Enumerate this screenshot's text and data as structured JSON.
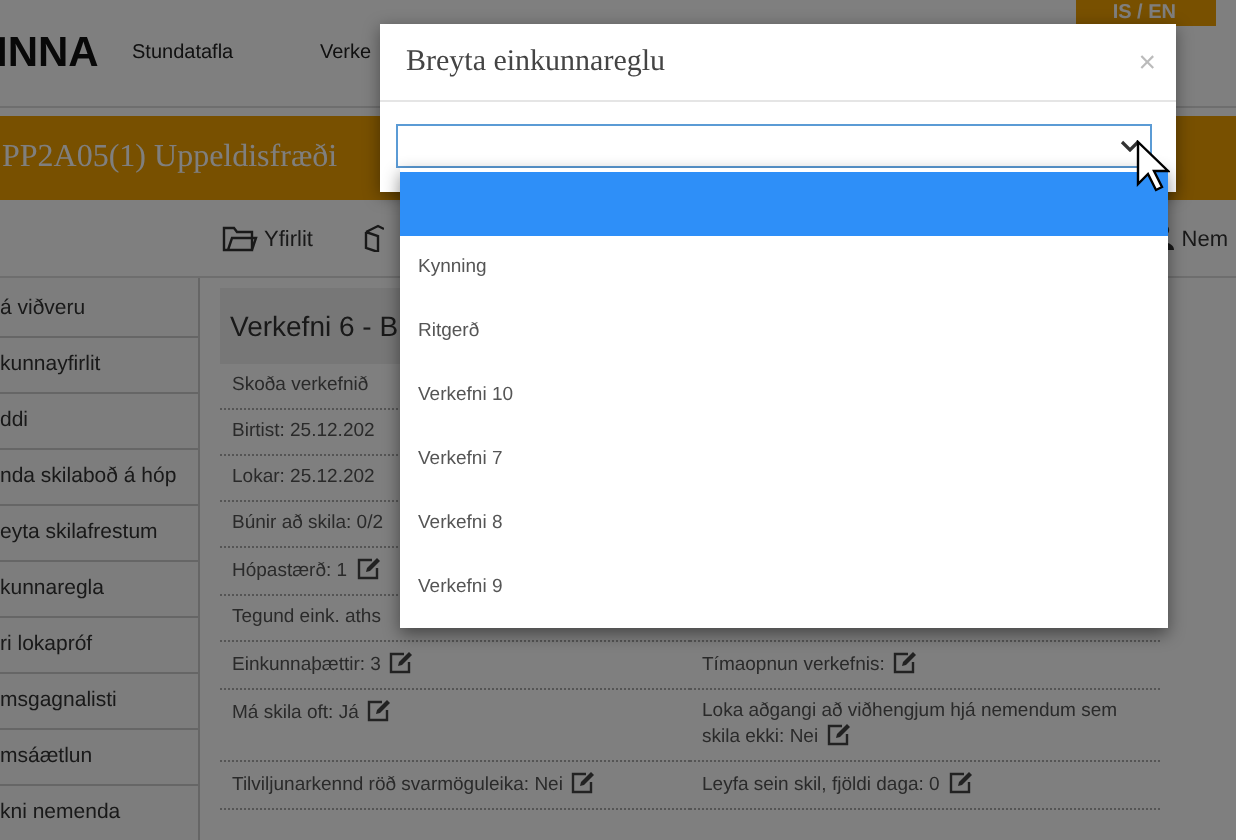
{
  "header": {
    "logo": "INNA",
    "nav": [
      "Stundatafla",
      "Verke"
    ],
    "language": "IS / EN"
  },
  "course_title": "PP2A05(1) Uppeldisfræði",
  "toolbar": [
    {
      "kind": "folder",
      "label": "Yfirlit"
    },
    {
      "kind": "box"
    },
    {
      "kind": "people",
      "label": "Nem"
    }
  ],
  "sidebar": {
    "items": [
      {
        "label": "á viðveru"
      },
      {
        "label": "kunnayfirlit"
      },
      {
        "label": "ddi"
      },
      {
        "label": "nda skilaboð á hóp"
      },
      {
        "label": "eyta skilafrestum"
      },
      {
        "label": "kunnaregla"
      },
      {
        "label": "ri lokapróf"
      },
      {
        "label": "msgagnalisti"
      },
      {
        "label": "msáætlun"
      },
      {
        "label": "kni nemenda"
      }
    ]
  },
  "assignment": {
    "title": "Verkefni 6 - B",
    "rows": [
      {
        "left": {
          "text": "Skoða verkefnið",
          "editable": false
        }
      },
      {
        "left": {
          "text": "Birtist: 25.12.202",
          "editable": false
        }
      },
      {
        "left": {
          "text": "Lokar: 25.12.202",
          "editable": false
        }
      },
      {
        "left": {
          "text": "Búnir að skila: 0/2",
          "editable": false
        }
      },
      {
        "left": {
          "text": "Hópastærð: 1",
          "editable": true
        }
      },
      {
        "left": {
          "text": "Tegund eink. aths",
          "editable": false
        }
      },
      {
        "left": {
          "text": "Einkunnaþættir: 3",
          "editable": true
        },
        "right": {
          "text": "Tímaopnun verkefnis:",
          "editable": true
        }
      },
      {
        "left": {
          "text": "Má skila oft: Já",
          "editable": true
        },
        "right": {
          "text": "Loka aðgangi að viðhengjum hjá nemendum sem skila ekki: Nei",
          "editable": true
        }
      },
      {
        "left": {
          "text": "Tilviljunarkennd röð svarmöguleika: Nei",
          "editable": true
        },
        "right": {
          "text": "Leyfa sein skil, fjöldi daga: 0",
          "editable": true
        }
      }
    ]
  },
  "dialog": {
    "title": "Breyta einkunnareglu",
    "close": "×",
    "select": {
      "expanded": true,
      "options": [
        {
          "selected": true
        },
        {
          "label": "Kynning",
          "selected": false
        },
        {
          "label": "Ritgerð",
          "selected": false
        },
        {
          "label": "Verkefni 10",
          "selected": false
        },
        {
          "label": "Verkefni 7",
          "selected": false
        },
        {
          "label": "Verkefni 8",
          "selected": false
        },
        {
          "label": "Verkefni 9",
          "selected": false
        }
      ]
    }
  }
}
